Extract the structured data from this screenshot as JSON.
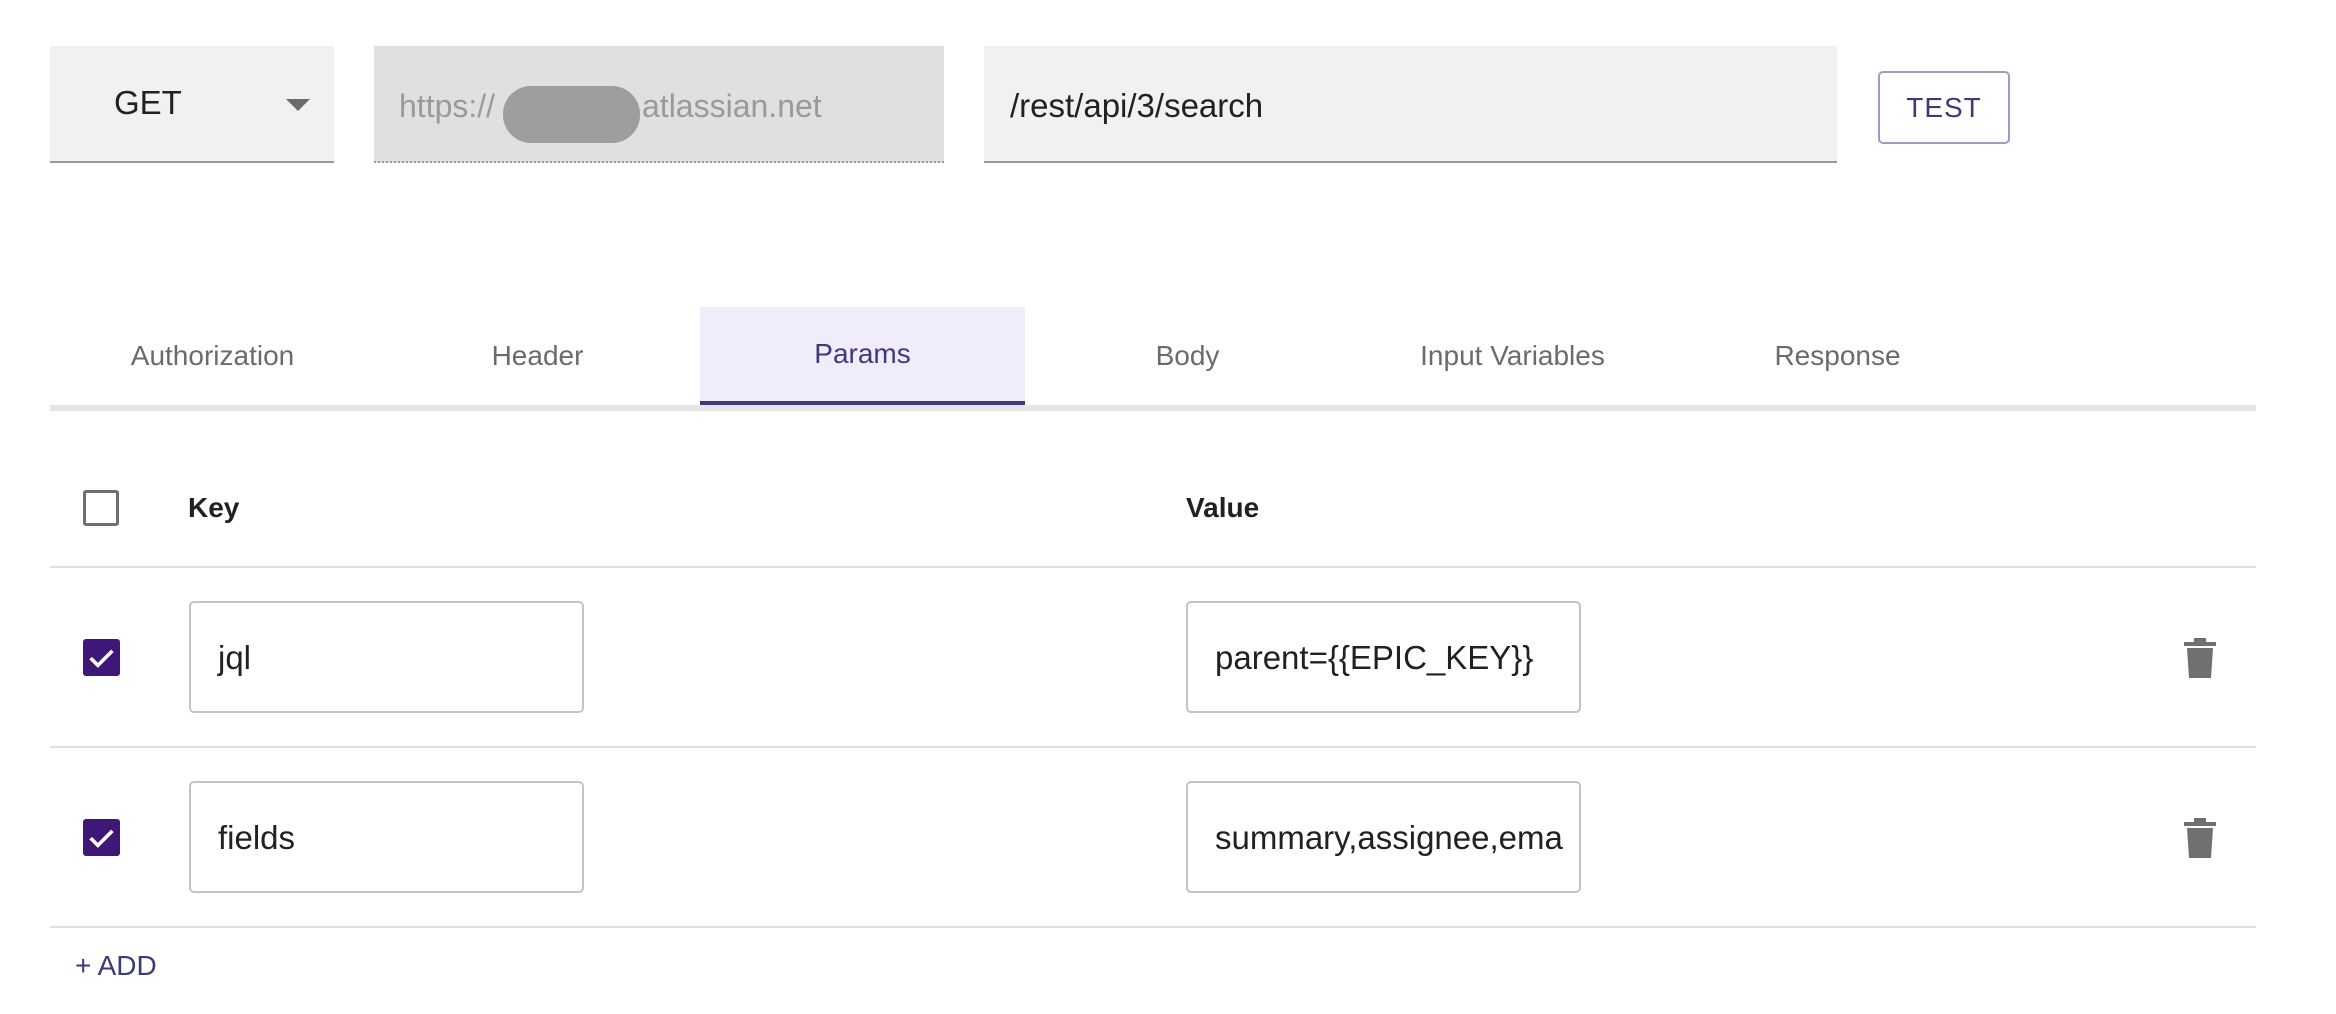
{
  "request": {
    "method": "GET",
    "base_url_prefix": "https://",
    "base_url_suffix": "atlassian.net",
    "path": "/rest/api/3/search",
    "test_label": "TEST"
  },
  "tabs": [
    {
      "label": "Authorization",
      "active": false
    },
    {
      "label": "Header",
      "active": false
    },
    {
      "label": "Params",
      "active": true
    },
    {
      "label": "Body",
      "active": false
    },
    {
      "label": "Input Variables",
      "active": false
    },
    {
      "label": "Response",
      "active": false
    }
  ],
  "params": {
    "header": {
      "key": "Key",
      "value": "Value",
      "select_all_checked": false
    },
    "rows": [
      {
        "checked": true,
        "key": "jql",
        "value": "parent={{EPIC_KEY}}",
        "delete_icon": "trash-icon"
      },
      {
        "checked": true,
        "key": "fields",
        "value": "summary,assignee,ema",
        "delete_icon": "trash-icon"
      }
    ],
    "add_label": "+ ADD"
  },
  "colors": {
    "accent": "#3d3a7a",
    "checkbox_checked": "#3e1778",
    "active_tab_bg": "#f1ecfa"
  }
}
